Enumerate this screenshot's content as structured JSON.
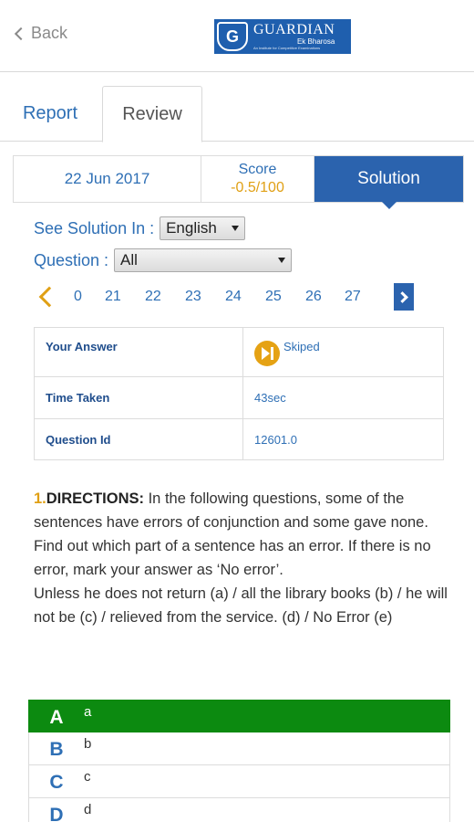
{
  "header": {
    "back_label": "Back",
    "logo": {
      "initial": "G",
      "name": "GUARDIAN",
      "tagline": "Ek Bharosa",
      "subtext": "An Institute for Competitive Examinations"
    }
  },
  "tabs": [
    {
      "label": "Report"
    },
    {
      "label": "Review"
    }
  ],
  "summary": {
    "date": "22 Jun 2017",
    "score_label": "Score",
    "score_value": "-0.5/100",
    "solution_label": "Solution"
  },
  "filters": {
    "language_label": "See Solution In :",
    "language_value": "English",
    "question_label": "Question :",
    "question_value": "All"
  },
  "pager": {
    "pages": [
      "0",
      "21",
      "22",
      "23",
      "24",
      "25",
      "26",
      "27"
    ]
  },
  "info": {
    "rows": [
      {
        "key": "Your Answer",
        "value": "Skiped"
      },
      {
        "key": "Time Taken",
        "value": "43sec"
      },
      {
        "key": "Question Id",
        "value": "12601.0"
      }
    ]
  },
  "question": {
    "number": "1.",
    "directions_label": "DIRECTIONS:",
    "directions_text": " In the following questions, some of the sentences have errors of conjunction and some gave none. Find out which part of a sentence has an error. If there is no error, mark your answer as ‘No error’.",
    "sentence": "Unless he does not return (a) / all the library books (b) / he will not be (c) / relieved from the service. (d) / No Error (e)"
  },
  "options": [
    {
      "letter": "A",
      "text": "a"
    },
    {
      "letter": "B",
      "text": "b"
    },
    {
      "letter": "C",
      "text": "c"
    },
    {
      "letter": "D",
      "text": "d"
    }
  ],
  "colors": {
    "primary": "#2b63ae",
    "accent": "#e0a015",
    "correct": "#0c8a10"
  }
}
